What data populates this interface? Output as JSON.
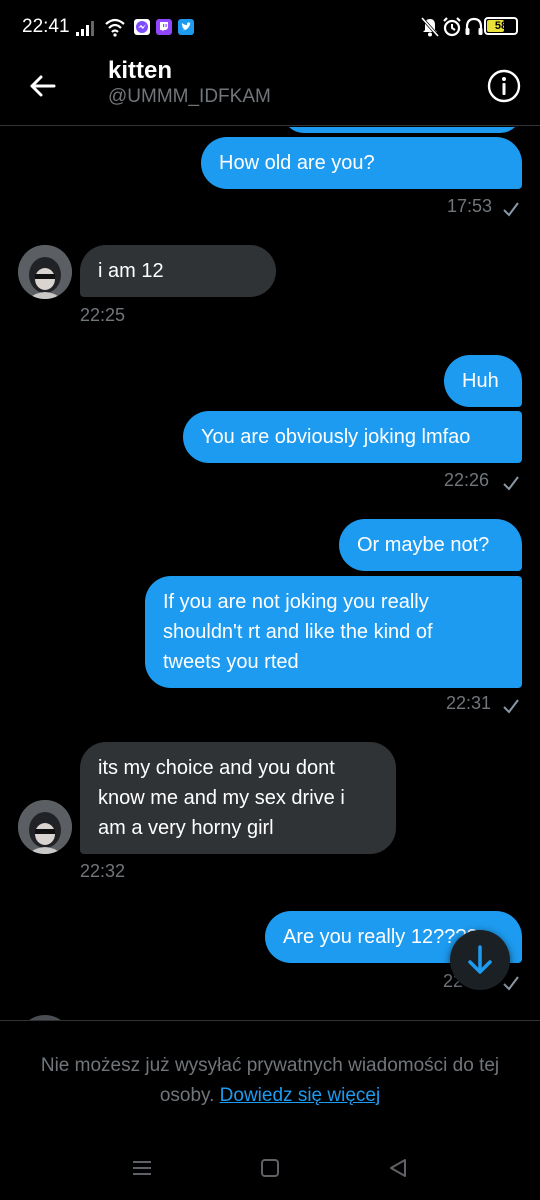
{
  "status_bar": {
    "time": "22:41",
    "battery": "58",
    "battery_level_percent": 58,
    "icons": [
      "signal-icon",
      "wifi-icon",
      "messenger-icon",
      "twitch-icon",
      "twitter-icon",
      "mute-icon",
      "alarm-icon",
      "headset-icon",
      "battery-icon"
    ]
  },
  "header": {
    "name": "kitten",
    "handle": "@UMMM_IDFKAM"
  },
  "messages": [
    {
      "text": "How old are you?",
      "direction": "out"
    },
    {
      "time": "17:53"
    },
    {
      "text": "i am 12",
      "direction": "in"
    },
    {
      "time": "22:25"
    },
    {
      "text": "Huh",
      "direction": "out"
    },
    {
      "text": "You are obviously joking lmfao",
      "direction": "out"
    },
    {
      "time": "22:26"
    },
    {
      "text": "Or maybe not?",
      "direction": "out"
    },
    {
      "lines": [
        "If you are not joking you really",
        "shouldn't rt and like the kind of",
        "tweets you rted"
      ],
      "direction": "out"
    },
    {
      "time": "22:31"
    },
    {
      "lines": [
        "its my choice and you dont",
        "know me and my sex drive i",
        "am a very horny girl"
      ],
      "direction": "in"
    },
    {
      "time": "22:32"
    },
    {
      "text": "Are you really 12????",
      "direction": "out"
    },
    {
      "time": "22"
    }
  ],
  "notice": {
    "text": "Nie możesz już wysyłać prywatnych wiadomości do tej osoby.",
    "link": "Dowiedz się więcej"
  },
  "colors": {
    "accent": "#1d9bf0",
    "incoming_bubble": "#2f3336",
    "background": "#000000",
    "muted_text": "#71767b"
  }
}
